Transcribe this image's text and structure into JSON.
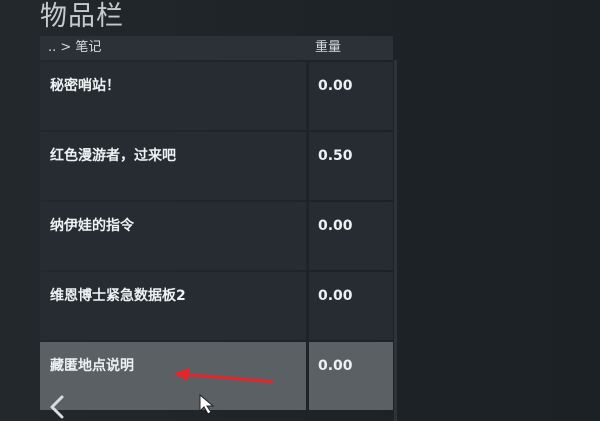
{
  "page_title": "物品栏",
  "header": {
    "breadcrumb": ".. > 笔记",
    "weight_label": "重量"
  },
  "items": [
    {
      "name": "秘密哨站！",
      "weight": "0.00",
      "selected": false
    },
    {
      "name": "红色漫游者，过来吧",
      "weight": "0.50",
      "selected": false
    },
    {
      "name": "纳伊娃的指令",
      "weight": "0.00",
      "selected": false
    },
    {
      "name": "维恩博士紧急数据板2",
      "weight": "0.00",
      "selected": false
    },
    {
      "name": "藏匿地点说明",
      "weight": "0.00",
      "selected": true
    }
  ],
  "icons": {
    "back": "chevron-left-icon",
    "cursor": "mouse-cursor-icon",
    "annotation": "red-arrow-annotation"
  },
  "colors": {
    "selected_row": "#5a6064",
    "row": "#262c31",
    "annotation": "#e8242a"
  }
}
